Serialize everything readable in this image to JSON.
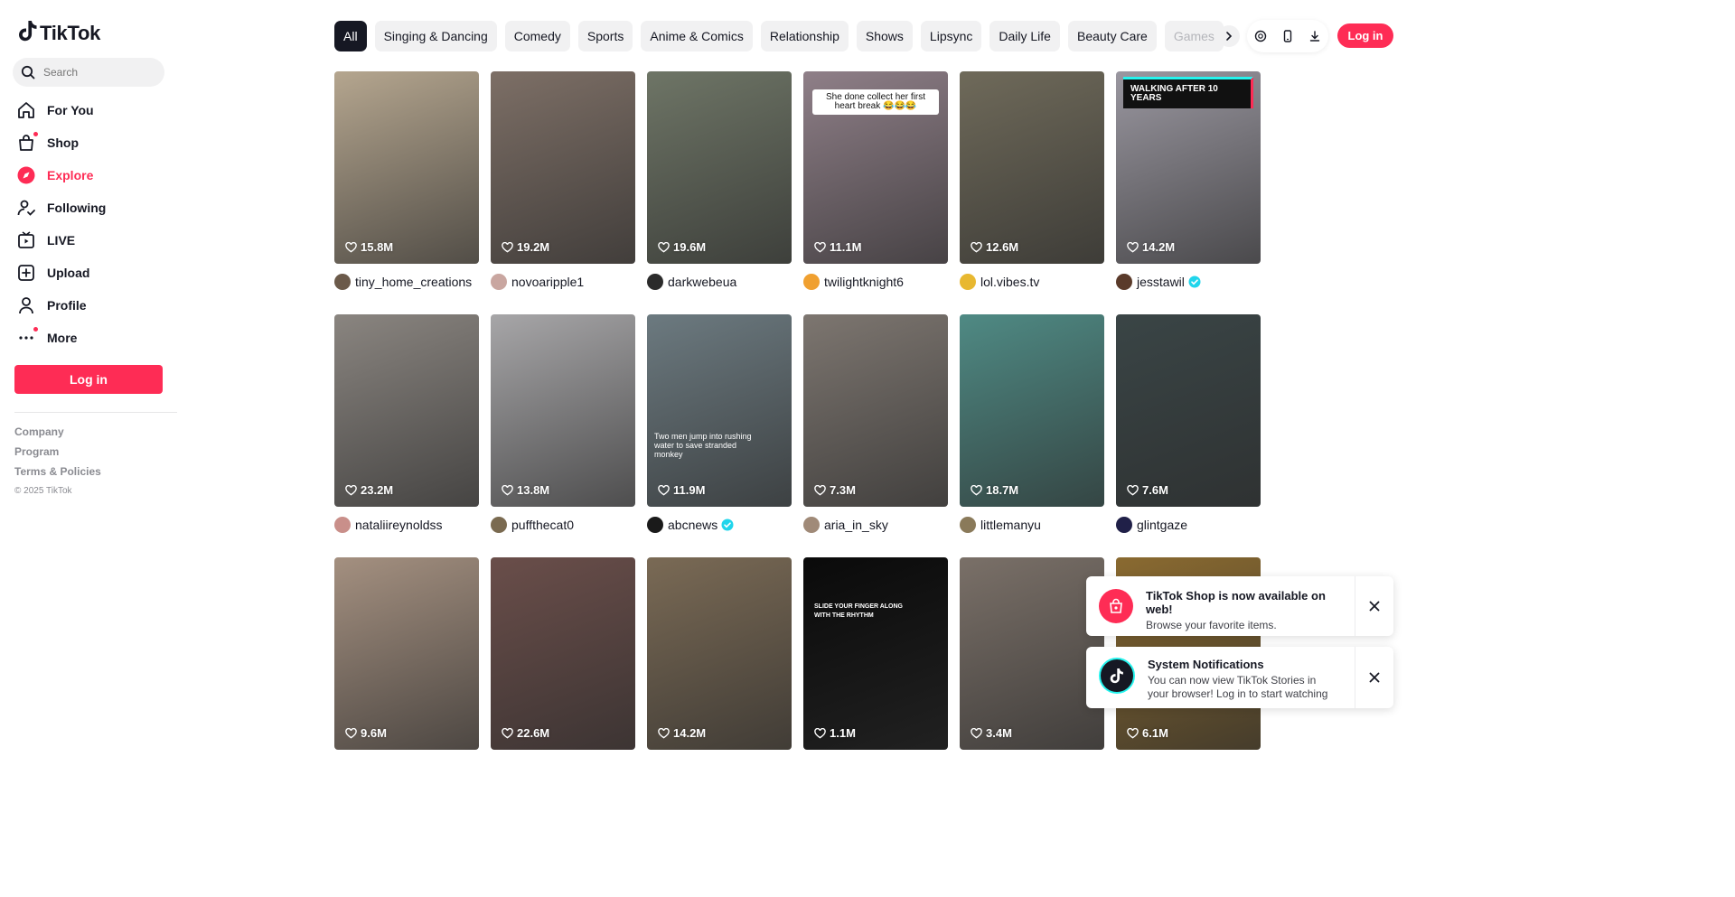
{
  "brand": {
    "name": "TikTok",
    "accent": "#fe2c55",
    "dark": "#161823"
  },
  "search": {
    "placeholder": "Search"
  },
  "nav": [
    {
      "label": "For You",
      "icon": "home-icon"
    },
    {
      "label": "Shop",
      "icon": "shopping-bag-icon",
      "dot": true
    },
    {
      "label": "Explore",
      "icon": "compass-icon",
      "active": true
    },
    {
      "label": "Following",
      "icon": "following-icon"
    },
    {
      "label": "LIVE",
      "icon": "live-tv-icon"
    },
    {
      "label": "Upload",
      "icon": "upload-plus-icon"
    },
    {
      "label": "Profile",
      "icon": "profile-icon"
    },
    {
      "label": "More",
      "icon": "more-dots-icon",
      "dot": true
    }
  ],
  "login_label": "Log in",
  "footer": {
    "company": "Company",
    "program": "Program",
    "terms": "Terms & Policies",
    "copyright": "© 2025 TikTok"
  },
  "categories": [
    "All",
    "Singing & Dancing",
    "Comedy",
    "Sports",
    "Anime & Comics",
    "Relationship",
    "Shows",
    "Lipsync",
    "Daily Life",
    "Beauty Care",
    "Games"
  ],
  "top_icons": [
    "coin-icon",
    "mobile-icon",
    "download-icon"
  ],
  "videos": [
    {
      "likes": "15.8M",
      "author": "tiny_home_creations",
      "verified": false,
      "bg": "#b5a68f",
      "avatar": "#6b5a4a"
    },
    {
      "likes": "19.2M",
      "author": "novoaripple1",
      "verified": false,
      "bg": "#7d6f66",
      "avatar": "#c9a6a0"
    },
    {
      "likes": "19.6M",
      "author": "darkwebeua",
      "verified": false,
      "bg": "#6e7566",
      "avatar": "#2b2b2b"
    },
    {
      "likes": "11.1M",
      "author": "twilightknight6",
      "verified": false,
      "bg": "#8f7f88",
      "avatar": "#f0a030",
      "caption": "She done collect her first heart break 😂😂😂"
    },
    {
      "likes": "12.6M",
      "author": "lol.vibes.tv",
      "verified": false,
      "bg": "#6f6a5a",
      "avatar": "#e8b830"
    },
    {
      "likes": "14.2M",
      "author": "jesstawil",
      "verified": true,
      "bg": "#9a97a0",
      "avatar": "#5a3a2a",
      "caption": "WALKING AFTER 10 YEARS"
    },
    {
      "likes": "23.2M",
      "author": "nataliireynoldss",
      "verified": false,
      "bg": "#8a8580",
      "avatar": "#c98f8a"
    },
    {
      "likes": "13.8M",
      "author": "puffthecat0",
      "verified": false,
      "bg": "#a7a6a8",
      "avatar": "#7a6a50"
    },
    {
      "likes": "11.9M",
      "author": "abcnews",
      "verified": true,
      "bg": "#6c7a80",
      "avatar": "#1a1a1a",
      "caption": "Two men jump into rushing water to save stranded monkey"
    },
    {
      "likes": "7.3M",
      "author": "aria_in_sky",
      "verified": false,
      "bg": "#7d7670",
      "avatar": "#a08a78"
    },
    {
      "likes": "18.7M",
      "author": "littlemanyu",
      "verified": false,
      "bg": "#4f8a84",
      "avatar": "#8a7a5a"
    },
    {
      "likes": "7.6M",
      "author": "glintgaze",
      "verified": false,
      "bg": "#3a4546",
      "avatar": "#202048"
    },
    {
      "likes": "9.6M",
      "author": "",
      "verified": false,
      "bg": "#a49080",
      "avatar": "#888"
    },
    {
      "likes": "22.6M",
      "author": "",
      "verified": false,
      "bg": "#6a4e4a",
      "avatar": "#888"
    },
    {
      "likes": "14.2M",
      "author": "",
      "verified": false,
      "bg": "#7a6a55",
      "avatar": "#888"
    },
    {
      "likes": "1.1M",
      "author": "",
      "verified": false,
      "bg": "#0a0a0a",
      "avatar": "#888",
      "caption": "SLIDE YOUR FINGER ALONG WITH THE RHYTHM"
    },
    {
      "likes": "3.4M",
      "author": "",
      "verified": false,
      "bg": "#7a7068",
      "avatar": "#888"
    },
    {
      "likes": "6.1M",
      "author": "",
      "verified": false,
      "bg": "#8a6a30",
      "avatar": "#888"
    }
  ],
  "toasts": [
    {
      "title": "TikTok Shop is now available on web!",
      "message": "Browse your favorite items.",
      "icon": "shop-bag-icon"
    },
    {
      "title": "System Notifications",
      "message": "You can now view TikTok Stories in your browser! Log in to start watching",
      "icon": "tiktok-logo-icon"
    }
  ]
}
